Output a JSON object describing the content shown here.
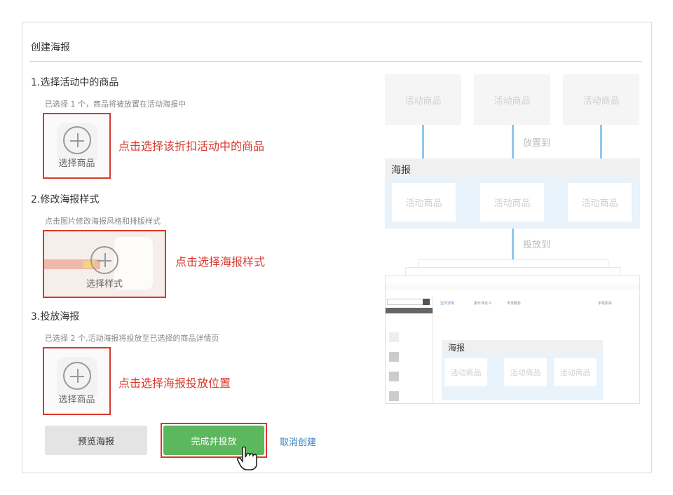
{
  "header": {
    "title": "创建海报"
  },
  "step1": {
    "title": "1.选择活动中的商品",
    "desc": "已选择 1 个，商品将被放置在活动海报中",
    "box_label": "选择商品",
    "hint": "点击选择该折扣活动中的商品"
  },
  "step2": {
    "title": "2.修改海报样式",
    "desc": "点击图片修改海报风格和排版样式",
    "box_label": "选择样式",
    "hint": "点击选择海报样式"
  },
  "step3": {
    "title": "3.投放海报",
    "desc": "已选择 2 个,活动海报将投放至已选择的商品详情页",
    "box_label": "选择商品",
    "hint": "点击选择海报投放位置"
  },
  "actions": {
    "preview": "预览海报",
    "finish": "完成并投放",
    "cancel": "取消创建"
  },
  "diagram": {
    "goods": "活动商品",
    "place_to": "放置到",
    "poster": "海报",
    "deliver_to": "投放到",
    "detail_tabs": [
      "宝贝详情",
      "累计评论 0",
      "专享服务"
    ],
    "detail_right": "手机购买"
  },
  "colors": {
    "accent_red": "#d9392d",
    "green": "#5cb85c",
    "link": "#3a7fc1",
    "diagram_blue": "#8fc7ee"
  }
}
